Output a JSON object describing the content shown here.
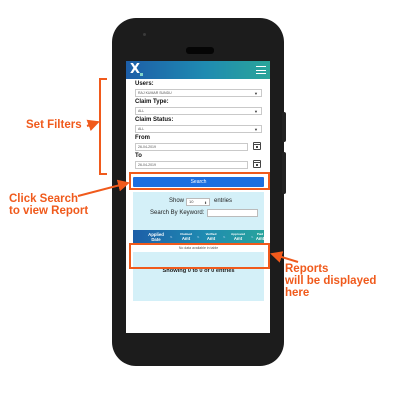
{
  "app": {
    "logo_text": "X",
    "header_color": "#1d5ea8",
    "menu_icon": "hamburger-menu-icon"
  },
  "filters": {
    "users_label": "Users:",
    "users_value": "RAJ KUMAR SUNDU",
    "claim_type_label": "Claim Type:",
    "claim_type_value": "ALL",
    "claim_status_label": "Claim Status:",
    "claim_status_value": "ALL",
    "from_label": "From",
    "from_value": "26-04-2019",
    "to_label": "To",
    "to_value": "26-04-2019",
    "calendar_icon": "calendar-icon",
    "search_label": "Search"
  },
  "report": {
    "show_label": "Show",
    "entries_value": "10",
    "entries_label": "entries",
    "keyword_label": "Search By Keyword:",
    "columns": [
      {
        "line1": "Applied",
        "line2": "Date",
        "size": "main"
      },
      {
        "line1": "Claimed",
        "line2": "Amt",
        "size": "small"
      },
      {
        "line1": "Verified",
        "line2": "Amt",
        "size": "small"
      },
      {
        "line1": "Approved",
        "line2": "Amt",
        "size": "small"
      },
      {
        "line1": "Paid",
        "line2": "Amt",
        "size": "small"
      }
    ],
    "empty_text": "No data available in table",
    "showing_text": "Showing 0 to 0 of 0 entries"
  },
  "annotations": {
    "set_filters": "Set Filters",
    "click_search_line1": "Click Search",
    "click_search_line2": "to view Report",
    "reports_line1": "Reports",
    "reports_line2": "will be displayed",
    "reports_line3": "here",
    "accent_color": "#f05a1c"
  }
}
